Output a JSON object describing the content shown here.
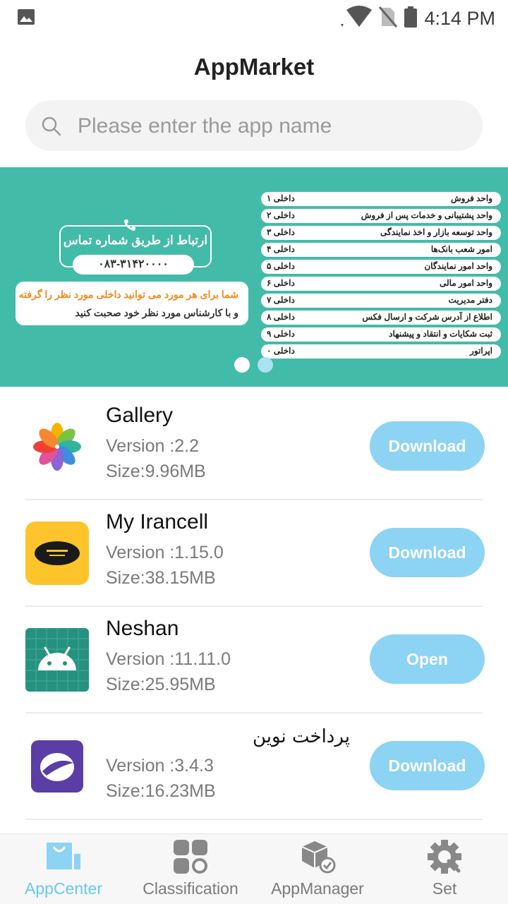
{
  "status_bar": {
    "time": "4:14 PM"
  },
  "header": {
    "title": "AppMarket"
  },
  "search": {
    "placeholder": "Please enter the app name"
  },
  "banner": {
    "contact_title": "ارتباط از طریق شماره تماس",
    "phone": "۰۸۳-۳۱۴۲۰۰۰۰",
    "note_line1": "شما برای هر مورد می توانید داخلی مورد نظر را گرفته",
    "note_line2": "و با کارشناس مورد نظر خود صحبت کنید",
    "extensions": [
      {
        "label": "واحد فروش",
        "num": "داخلی ۱"
      },
      {
        "label": "واحد پشتیبانی و خدمات پس از فروش",
        "num": "داخلی ۲"
      },
      {
        "label": "واحد توسعه بازار و اخذ نمایندگی",
        "num": "داخلی ۳"
      },
      {
        "label": "امور شعب بانک‌ها",
        "num": "داخلی ۴"
      },
      {
        "label": "واحد امور نمایندگان",
        "num": "داخلی ۵"
      },
      {
        "label": "واحد امور مالی",
        "num": "داخلی ۶"
      },
      {
        "label": "دفتر مدیریت",
        "num": "داخلی ۷"
      },
      {
        "label": "اطلاع از آدرس شرکت و ارسال فکس",
        "num": "داخلی ۸"
      },
      {
        "label": "ثبت شکایات و انتقاد و پیشنهاد",
        "num": "داخلی ۹"
      },
      {
        "label": "اپراتور",
        "num": "داخلی ۰"
      }
    ]
  },
  "apps": [
    {
      "name": "Gallery",
      "version": "Version :2.2",
      "size": "Size:9.96MB",
      "button": "Download",
      "icon": "gallery-icon"
    },
    {
      "name": "My Irancell",
      "version": "Version :1.15.0",
      "size": "Size:38.15MB",
      "button": "Download",
      "icon": "irancell-icon"
    },
    {
      "name": "Neshan",
      "version": "Version :11.11.0",
      "size": "Size:25.95MB",
      "button": "Open",
      "icon": "android-icon"
    },
    {
      "name": "پرداخت نوین",
      "version": "Version :3.4.3",
      "size": "Size:16.23MB",
      "button": "Download",
      "icon": "novin-icon"
    }
  ],
  "tabs": [
    {
      "label": "AppCenter",
      "active": true
    },
    {
      "label": "Classification"
    },
    {
      "label": "AppManager"
    },
    {
      "label": "Set"
    }
  ],
  "colors": {
    "accent": "#69c8ef",
    "button": "#8dd3f3",
    "banner": "#43bba9"
  }
}
